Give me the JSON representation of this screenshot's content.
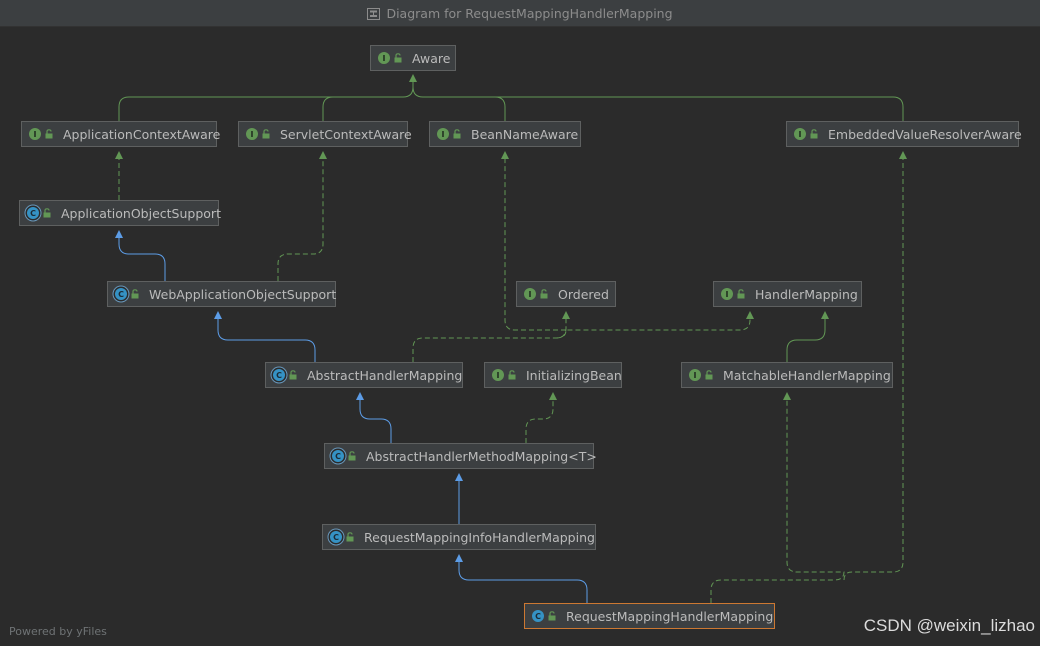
{
  "title": "Diagram for RequestMappingHandlerMapping",
  "footer": "Powered by yFiles",
  "watermark": "CSDN @weixin_lizhao",
  "colors": {
    "background": "#2b2b2b",
    "node_fill": "#3c3f41",
    "node_border": "#5e6060",
    "selected_border": "#cc7832",
    "interface_badge": "#629755",
    "class_badge": "#3592c4",
    "implements_edge": "#629755",
    "extends_edge": "#5c9ce6"
  },
  "nodes": [
    {
      "id": "aware",
      "label": "Aware",
      "kind": "interface"
    },
    {
      "id": "appctx",
      "label": "ApplicationContextAware",
      "kind": "interface"
    },
    {
      "id": "servletctx",
      "label": "ServletContextAware",
      "kind": "interface"
    },
    {
      "id": "beanname",
      "label": "BeanNameAware",
      "kind": "interface"
    },
    {
      "id": "embedded",
      "label": "EmbeddedValueResolverAware",
      "kind": "interface"
    },
    {
      "id": "appobj",
      "label": "ApplicationObjectSupport",
      "kind": "abstract-class"
    },
    {
      "id": "webappobj",
      "label": "WebApplicationObjectSupport",
      "kind": "abstract-class"
    },
    {
      "id": "ordered",
      "label": "Ordered",
      "kind": "interface"
    },
    {
      "id": "handlermapping",
      "label": "HandlerMapping",
      "kind": "interface"
    },
    {
      "id": "abshm",
      "label": "AbstractHandlerMapping",
      "kind": "abstract-class"
    },
    {
      "id": "initbean",
      "label": "InitializingBean",
      "kind": "interface"
    },
    {
      "id": "matchable",
      "label": "MatchableHandlerMapping",
      "kind": "interface"
    },
    {
      "id": "abshmm",
      "label": "AbstractHandlerMethodMapping<T>",
      "kind": "abstract-class"
    },
    {
      "id": "rmihm",
      "label": "RequestMappingInfoHandlerMapping",
      "kind": "abstract-class"
    },
    {
      "id": "rmhm",
      "label": "RequestMappingHandlerMapping",
      "kind": "class",
      "selected": true
    }
  ],
  "edges": [
    {
      "from": "appctx",
      "to": "aware",
      "type": "extends-interface"
    },
    {
      "from": "servletctx",
      "to": "aware",
      "type": "extends-interface"
    },
    {
      "from": "beanname",
      "to": "aware",
      "type": "extends-interface"
    },
    {
      "from": "embedded",
      "to": "aware",
      "type": "extends-interface"
    },
    {
      "from": "appobj",
      "to": "appctx",
      "type": "implements"
    },
    {
      "from": "webappobj",
      "to": "appobj",
      "type": "extends"
    },
    {
      "from": "webappobj",
      "to": "servletctx",
      "type": "implements"
    },
    {
      "from": "abshm",
      "to": "webappobj",
      "type": "extends"
    },
    {
      "from": "abshm",
      "to": "ordered",
      "type": "implements"
    },
    {
      "from": "abshm",
      "to": "handlermapping",
      "type": "implements"
    },
    {
      "from": "abshm",
      "to": "beanname",
      "type": "implements"
    },
    {
      "from": "matchable",
      "to": "handlermapping",
      "type": "extends-interface"
    },
    {
      "from": "abshmm",
      "to": "abshm",
      "type": "extends"
    },
    {
      "from": "abshmm",
      "to": "initbean",
      "type": "implements"
    },
    {
      "from": "rmihm",
      "to": "abshmm",
      "type": "extends"
    },
    {
      "from": "rmhm",
      "to": "rmihm",
      "type": "extends"
    },
    {
      "from": "rmhm",
      "to": "matchable",
      "type": "implements"
    },
    {
      "from": "rmhm",
      "to": "embedded",
      "type": "implements"
    }
  ]
}
